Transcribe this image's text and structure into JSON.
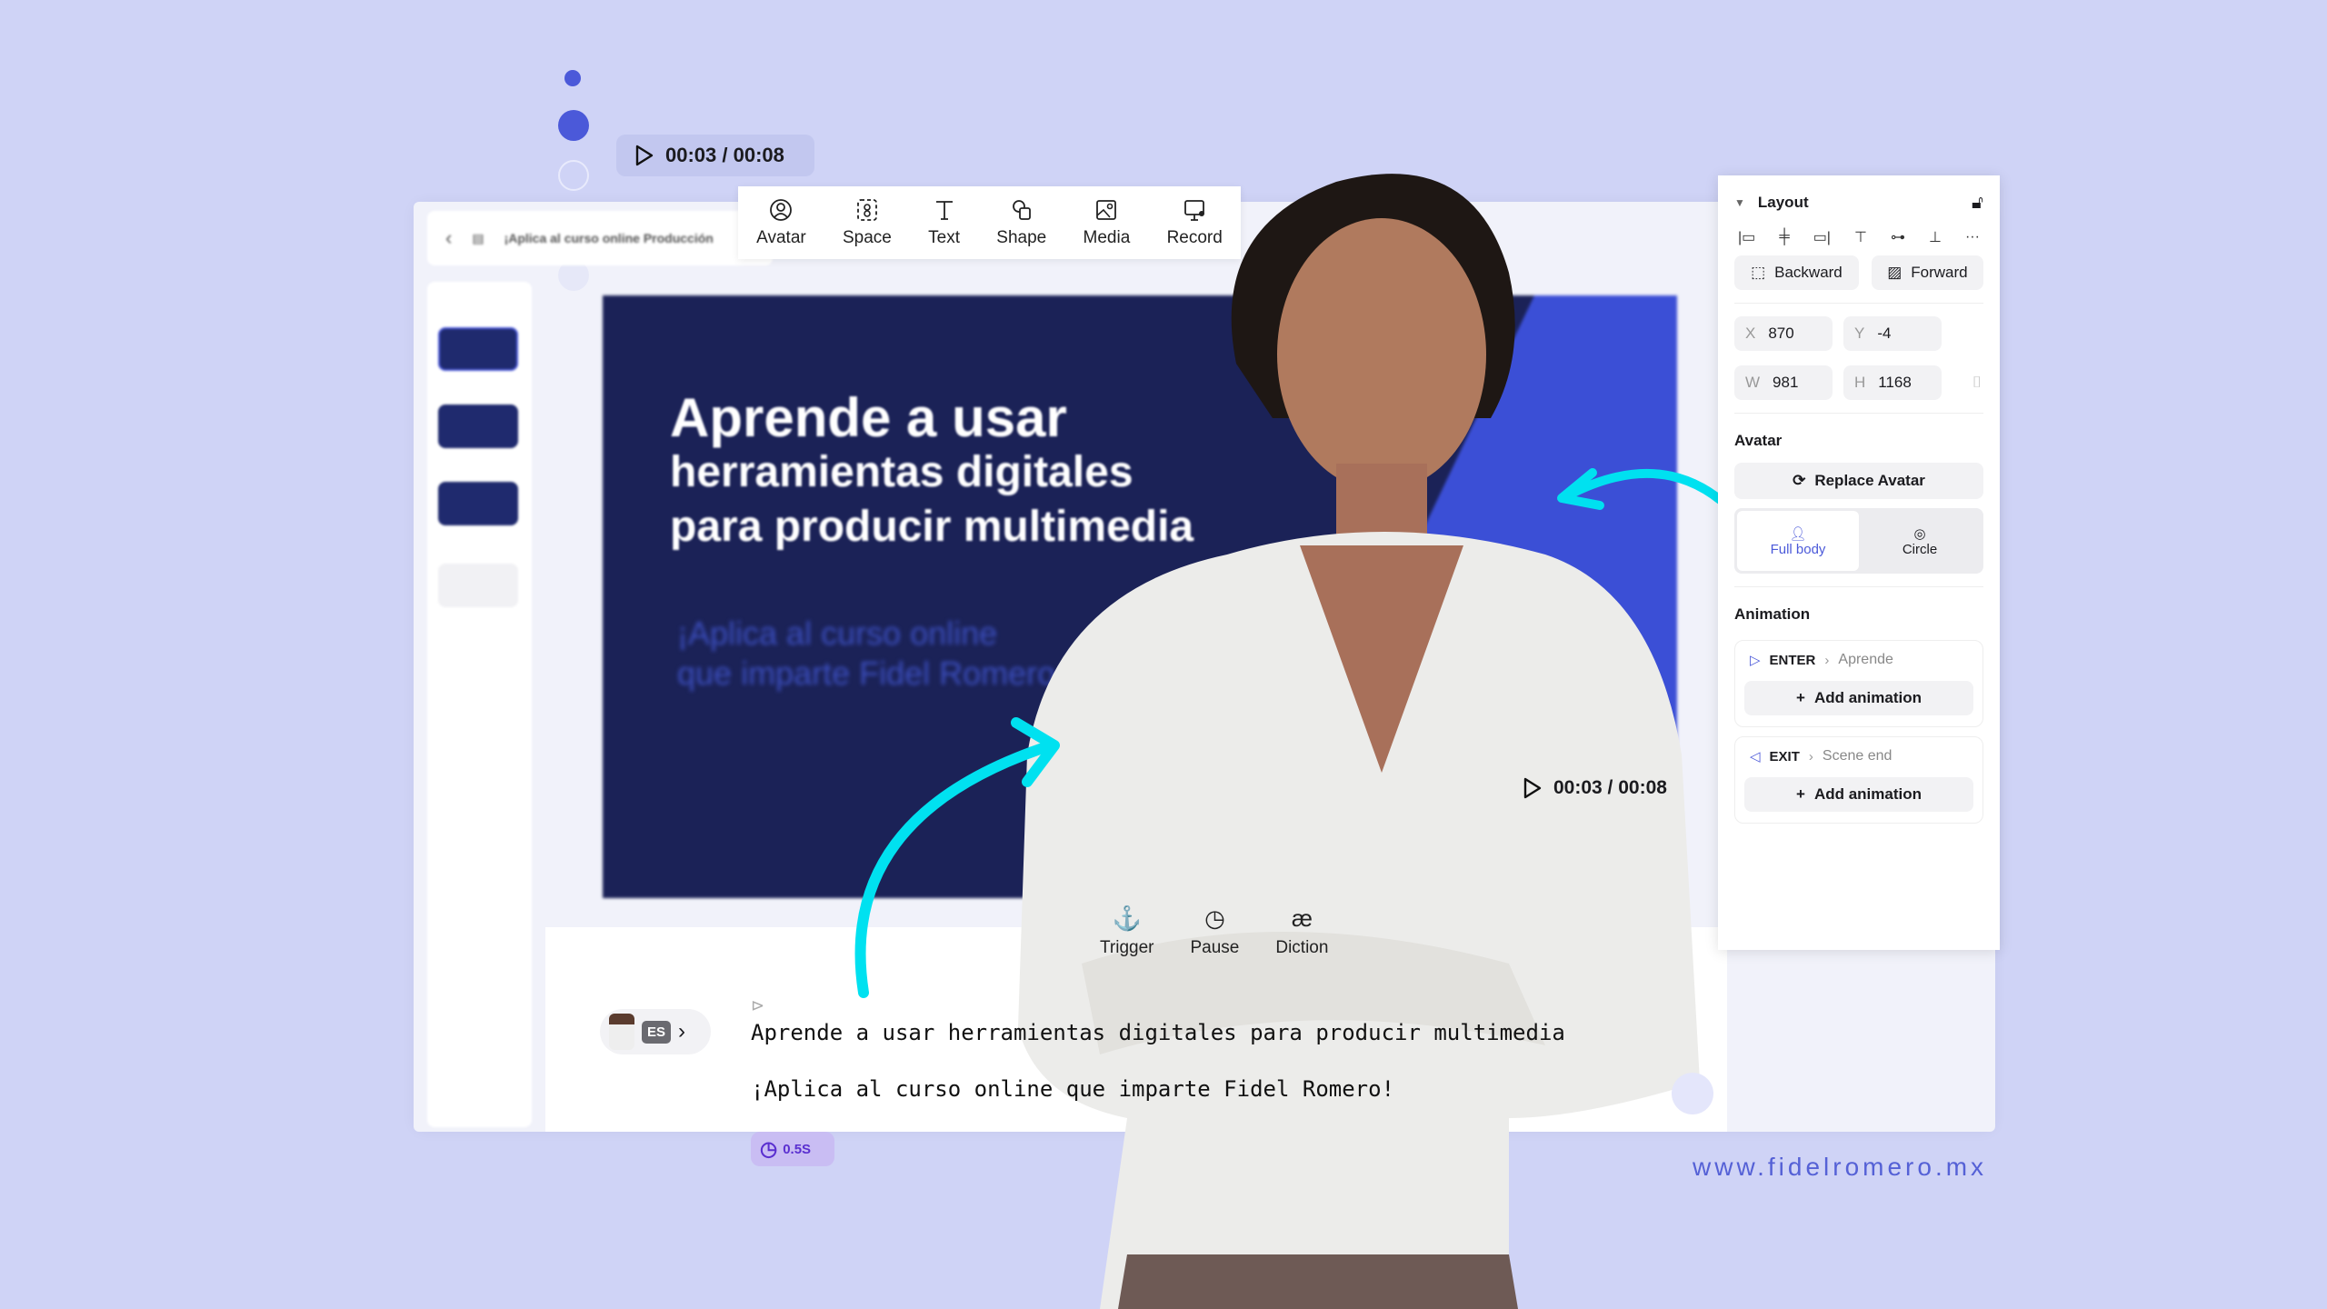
{
  "playback": {
    "time": "00:03 / 00:08",
    "overlay_time": "00:03 / 00:08"
  },
  "editor": {
    "project_title": "¡Aplica al curso online Producción"
  },
  "toolbar": {
    "items": [
      {
        "label": "Avatar",
        "icon": "avatar-icon"
      },
      {
        "label": "Space",
        "icon": "space-icon"
      },
      {
        "label": "Text",
        "icon": "text-icon"
      },
      {
        "label": "Shape",
        "icon": "shape-icon"
      },
      {
        "label": "Media",
        "icon": "media-icon"
      },
      {
        "label": "Record",
        "icon": "record-icon"
      }
    ]
  },
  "slide": {
    "headline_1": "Aprende a usar",
    "headline_2": "herramientas digitales",
    "headline_3": "para producir multimedia",
    "sub_1": "¡Aplica al curso online",
    "sub_2": "que imparte Fidel Romero"
  },
  "script": {
    "tools": [
      {
        "label": "Trigger"
      },
      {
        "label": "Pause"
      },
      {
        "label": "Diction"
      }
    ],
    "language": "ES",
    "line_1": "Aprende a usar herramientas digitales para producir multimedia",
    "line_2": "¡Aplica al curso online que imparte Fidel Romero!",
    "pause_badge": "0.5S"
  },
  "panel": {
    "layout_title": "Layout",
    "backward": "Backward",
    "forward": "Forward",
    "x_label": "X",
    "x": "870",
    "y_label": "Y",
    "y": "-4",
    "w_label": "W",
    "w": "981",
    "h_label": "H",
    "h": "1168",
    "avatar_title": "Avatar",
    "replace_avatar": "Replace Avatar",
    "full_body": "Full body",
    "circle": "Circle",
    "animation_title": "Animation",
    "enter_label": "ENTER",
    "enter_target": "Aprende",
    "exit_label": "EXIT",
    "exit_target": "Scene end",
    "add_animation": "Add animation"
  },
  "website": "www.fidelromero.mx",
  "colors": {
    "background": "#cfd3f6",
    "accent": "#4b59d9",
    "arrow": "#00e1f0",
    "slide": "#1b2257"
  }
}
